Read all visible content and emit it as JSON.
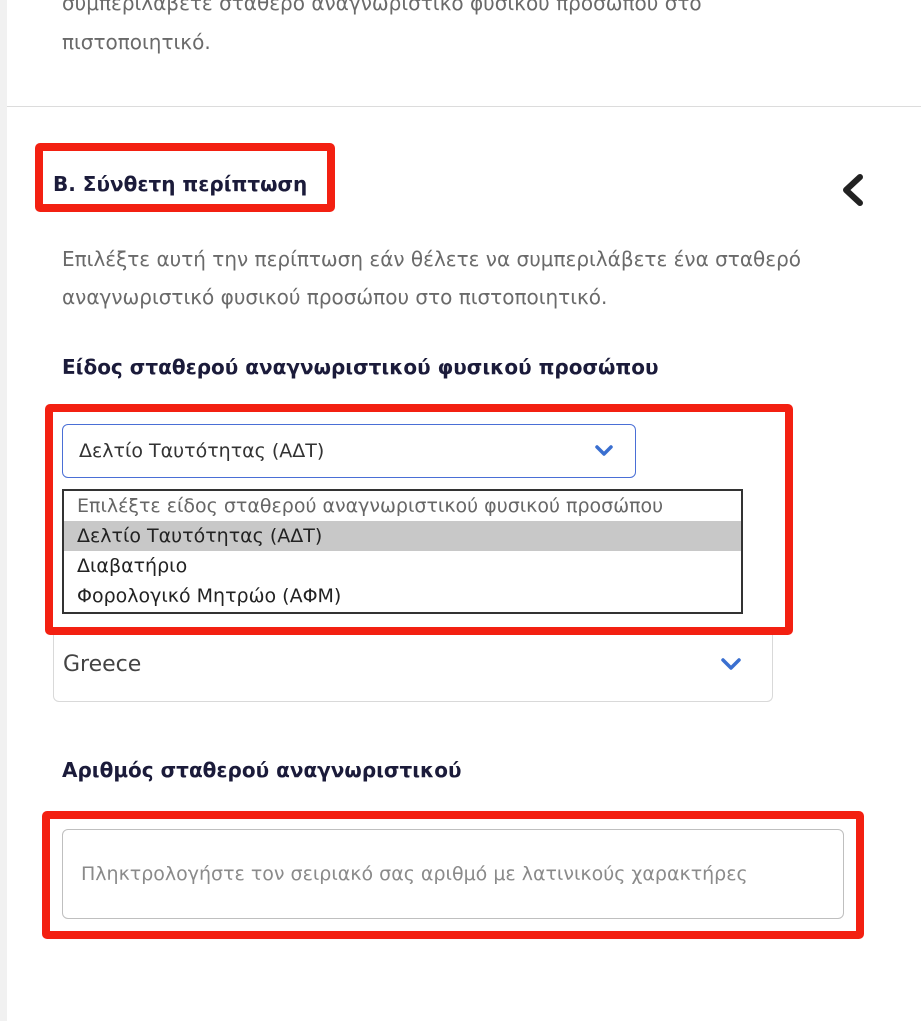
{
  "top_text_cut": "συμπεριλάβετε σταθερό αναγνωριστικό φυσικού προσώπου στο",
  "top_text": "πιστοποιητικό.",
  "section": {
    "title": "Β. Σύνθετη περίπτωση",
    "description": "Επιλέξτε αυτή την περίπτωση εάν θέλετε να συμπεριλάβετε ένα σταθερό αναγνωριστικό φυσικού προσώπου στο πιστοποιητικό.",
    "collapse_icon": "chevron-left-icon"
  },
  "id_type": {
    "label": "Είδος σταθερού αναγνωριστικού φυσικού προσώπου",
    "selected_value": "Δελτίο Ταυτότητας (ΑΔΤ)",
    "options": [
      "Επιλέξτε είδος σταθερού αναγνωριστικού φυσικού προσώπου",
      "Δελτίο Ταυτότητας (ΑΔΤ)",
      "Διαβατήριο",
      "Φορολογικό Μητρώο (ΑΦΜ)"
    ],
    "selected_index": 1
  },
  "country": {
    "value": "Greece"
  },
  "id_number": {
    "label": "Αριθμός σταθερού αναγνωριστικού",
    "value": "",
    "placeholder": "Πληκτρολογήστε τον σειριακό σας αριθμό με λατινικούς χαρακτήρες"
  },
  "colors": {
    "highlight": "#f32011",
    "focus_border": "#4a6fd6",
    "chevron": "#3a6fd0",
    "heading": "#1b1b3a",
    "selected_option": "#c8c8c8"
  }
}
